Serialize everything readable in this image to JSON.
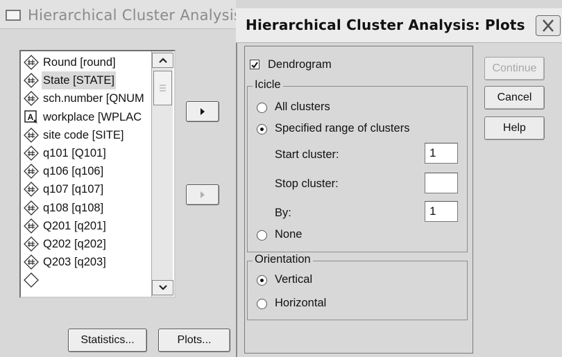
{
  "background_dialog": {
    "title": "Hierarchical Cluster Analysis",
    "variables": [
      {
        "label": "Round [round]",
        "icon": "scale-icon",
        "selected": false
      },
      {
        "label": "State [STATE]",
        "icon": "scale-icon",
        "selected": true
      },
      {
        "label": "sch.number [QNUM",
        "icon": "scale-icon",
        "selected": false
      },
      {
        "label": "workplace [WPLAC",
        "icon": "string-icon",
        "selected": false
      },
      {
        "label": "site code [SITE]",
        "icon": "scale-icon",
        "selected": false
      },
      {
        "label": "q101 [Q101]",
        "icon": "scale-icon",
        "selected": false
      },
      {
        "label": "q106 [q106]",
        "icon": "scale-icon",
        "selected": false
      },
      {
        "label": "q107 [q107]",
        "icon": "scale-icon",
        "selected": false
      },
      {
        "label": "q108 [q108]",
        "icon": "scale-icon",
        "selected": false
      },
      {
        "label": "Q201 [q201]",
        "icon": "scale-icon",
        "selected": false
      },
      {
        "label": "Q202 [q202]",
        "icon": "scale-icon",
        "selected": false
      },
      {
        "label": "Q203 [q203]",
        "icon": "scale-icon",
        "selected": false
      }
    ],
    "statistics_label": "Statistics...",
    "plots_label": "Plots..."
  },
  "plots_dialog": {
    "title": "Hierarchical Cluster Analysis: Plots",
    "dendrogram_label": "Dendrogram",
    "dendrogram_checked": true,
    "icicle": {
      "legend": "Icicle",
      "all_clusters": "All clusters",
      "specified_range": "Specified range of clusters",
      "start_cluster_label": "Start cluster:",
      "start_cluster_value": "1",
      "stop_cluster_label": "Stop cluster:",
      "stop_cluster_value": "",
      "by_label": "By:",
      "by_value": "1",
      "none": "None",
      "selected": "specified_range"
    },
    "orientation": {
      "legend": "Orientation",
      "vertical": "Vertical",
      "horizontal": "Horizontal",
      "selected": "vertical"
    },
    "buttons": {
      "continue": "Continue",
      "cancel": "Cancel",
      "help": "Help"
    }
  }
}
